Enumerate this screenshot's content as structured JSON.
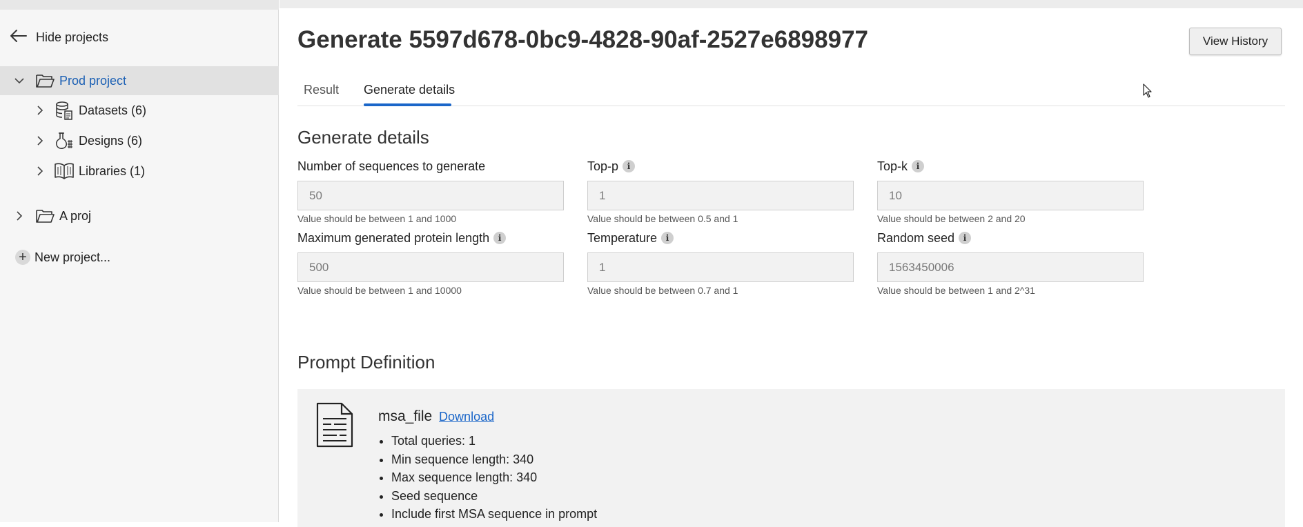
{
  "sidebar": {
    "hide_projects": "Hide projects",
    "projects": [
      {
        "name": "Prod project",
        "expanded": true,
        "selected": true,
        "children": [
          {
            "label": "Datasets (6)",
            "icon": "database-icon"
          },
          {
            "label": "Designs (6)",
            "icon": "flask-icon"
          },
          {
            "label": "Libraries (1)",
            "icon": "book-icon"
          }
        ]
      },
      {
        "name": "A proj",
        "expanded": false,
        "selected": false
      }
    ],
    "new_project": "New project..."
  },
  "header": {
    "title": "Generate 5597d678-0bc9-4828-90af-2527e6898977",
    "view_history": "View History"
  },
  "tabs": [
    {
      "label": "Result",
      "active": false
    },
    {
      "label": "Generate details",
      "active": true
    }
  ],
  "details": {
    "title": "Generate details",
    "fields": [
      {
        "label": "Number of sequences to generate",
        "value": "50",
        "help": "Value should be between 1 and 1000",
        "info": false
      },
      {
        "label": "Top-p",
        "value": "1",
        "help": "Value should be between 0.5 and 1",
        "info": true
      },
      {
        "label": "Top-k",
        "value": "10",
        "help": "Value should be between 2 and 20",
        "info": true
      },
      {
        "label": "Maximum generated protein length",
        "value": "500",
        "help": "Value should be between 1 and 10000",
        "info": true
      },
      {
        "label": "Temperature",
        "value": "1",
        "help": "Value should be between 0.7 and 1",
        "info": true
      },
      {
        "label": "Random seed",
        "value": "1563450006",
        "help": "Value should be between 1 and 2^31",
        "info": true
      }
    ]
  },
  "prompt": {
    "title": "Prompt Definition",
    "file_name": "msa_file",
    "download": "Download",
    "stats": [
      "Total queries: 1",
      "Min sequence length: 340",
      "Max sequence length: 340",
      "Seed sequence",
      "Include first MSA sequence in prompt"
    ]
  },
  "colors": {
    "accent": "#1a66c9",
    "selected_text": "#1a5fb4",
    "sidebar_bg": "#f6f6f6",
    "input_bg": "#f2f2f2"
  }
}
